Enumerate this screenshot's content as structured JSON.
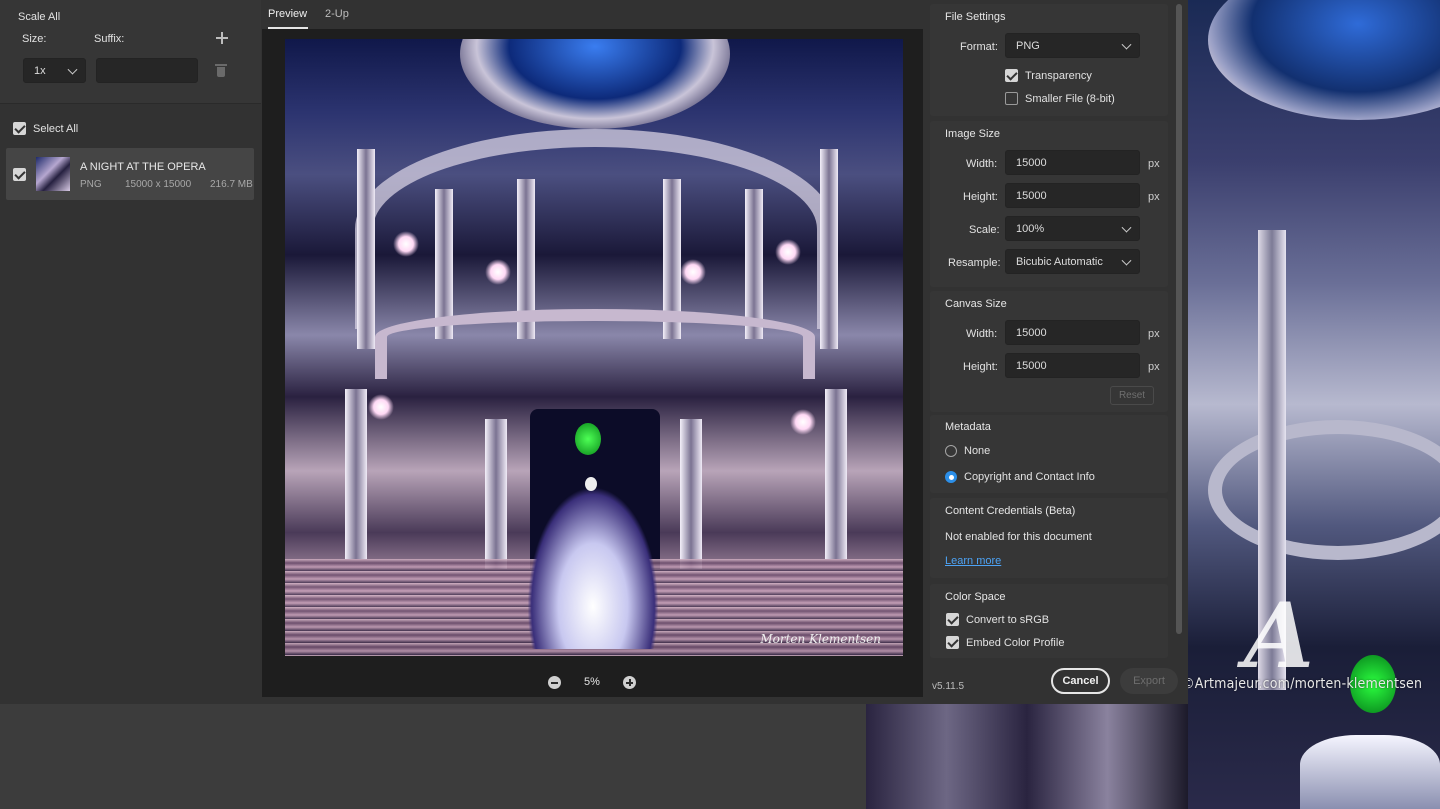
{
  "background": {
    "watermark": "©Artmajeur.com/morten-klementsen",
    "logo_glyph": "A"
  },
  "left_panel": {
    "scale_all_title": "Scale All",
    "size_label": "Size:",
    "suffix_label": "Suffix:",
    "size_value": "1x",
    "suffix_value": "",
    "select_all_label": "Select All",
    "file": {
      "name": "A NIGHT AT THE OPERA",
      "format": "PNG",
      "dimensions": "15000 x 15000",
      "file_size": "216.7 MB"
    }
  },
  "center": {
    "tabs": [
      {
        "label": "Preview"
      },
      {
        "label": "2-Up"
      }
    ],
    "zoom_level": "5%",
    "signature": "Morten Klementsen"
  },
  "right_panel": {
    "file_settings": {
      "title": "File Settings",
      "format_label": "Format:",
      "format_value": "PNG",
      "transparency_label": "Transparency",
      "smaller_file_label": "Smaller File (8-bit)"
    },
    "image_size": {
      "title": "Image Size",
      "width_label": "Width:",
      "width_value": "15000",
      "height_label": "Height:",
      "height_value": "15000",
      "unit": "px",
      "scale_label": "Scale:",
      "scale_value": "100%",
      "resample_label": "Resample:",
      "resample_value": "Bicubic Automatic"
    },
    "canvas_size": {
      "title": "Canvas Size",
      "width_label": "Width:",
      "width_value": "15000",
      "height_label": "Height:",
      "height_value": "15000",
      "unit": "px",
      "reset_label": "Reset"
    },
    "metadata": {
      "title": "Metadata",
      "none_label": "None",
      "copyright_label": "Copyright and Contact Info"
    },
    "content_credentials": {
      "title": "Content Credentials (Beta)",
      "status_text": "Not enabled for this document",
      "learn_more": "Learn more"
    },
    "color_space": {
      "title": "Color Space",
      "convert_label": "Convert to sRGB",
      "embed_label": "Embed Color Profile"
    },
    "version": "v5.11.5",
    "cancel_label": "Cancel",
    "export_label": "Export"
  }
}
